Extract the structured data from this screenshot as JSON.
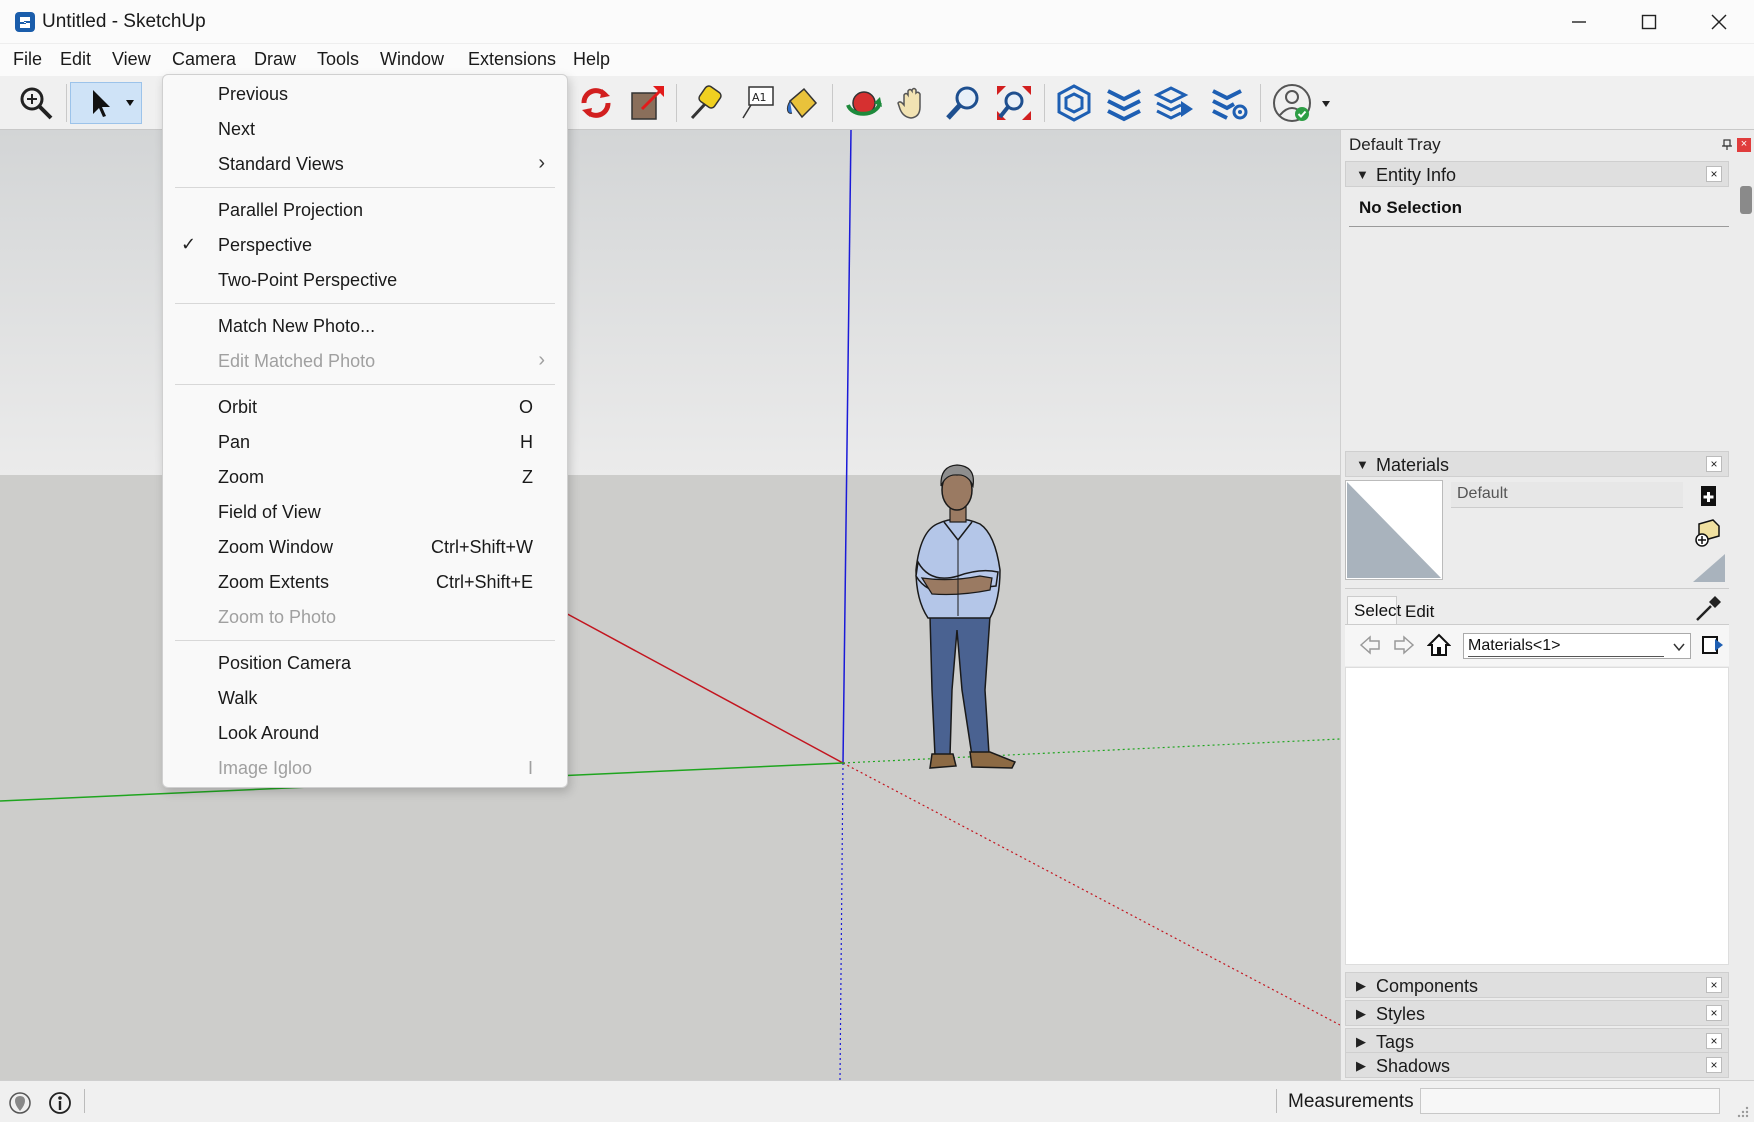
{
  "window": {
    "title": "Untitled - SketchUp",
    "minimize_icon": "minimize-icon",
    "maximize_icon": "maximize-icon",
    "close_icon": "close-icon"
  },
  "menubar": {
    "items": [
      "File",
      "Edit",
      "View",
      "Camera",
      "Draw",
      "Tools",
      "Window",
      "Extensions",
      "Help"
    ]
  },
  "camera_menu": {
    "previous": "Previous",
    "next": "Next",
    "standard_views": "Standard Views",
    "parallel_projection": "Parallel Projection",
    "perspective": "Perspective",
    "perspective_checked": true,
    "two_point_perspective": "Two-Point Perspective",
    "match_new_photo": "Match New Photo...",
    "edit_matched_photo": "Edit Matched Photo",
    "orbit": "Orbit",
    "orbit_shortcut": "O",
    "pan": "Pan",
    "pan_shortcut": "H",
    "zoom": "Zoom",
    "zoom_shortcut": "Z",
    "field_of_view": "Field of View",
    "zoom_window": "Zoom Window",
    "zoom_window_shortcut": "Ctrl+Shift+W",
    "zoom_extents": "Zoom Extents",
    "zoom_extents_shortcut": "Ctrl+Shift+E",
    "zoom_to_photo": "Zoom to Photo",
    "position_camera": "Position Camera",
    "walk": "Walk",
    "look_around": "Look Around",
    "image_igloo": "Image Igloo",
    "image_igloo_shortcut": "I",
    "check_mark": "✓",
    "submenu_arrow": "›"
  },
  "tray": {
    "title": "Default Tray",
    "entity_info": {
      "title": "Entity Info",
      "selection": "No Selection"
    },
    "materials": {
      "title": "Materials",
      "current_name": "Default",
      "select_tab": "Select",
      "edit_tab": "Edit",
      "library": "Materials<1>"
    },
    "components": "Components",
    "styles": "Styles",
    "tags": "Tags",
    "shadows": "Shadows",
    "close_glyph": "×"
  },
  "statusbar": {
    "measurements_label": "Measurements",
    "measurements_value": ""
  },
  "colors": {
    "sky": "#e3e4e4",
    "ground": "#cdcdcb",
    "axis_red": "#c3151f",
    "axis_green": "#1fa51f",
    "axis_blue": "#1a1ad8",
    "accent_blue": "#1a5dab"
  }
}
